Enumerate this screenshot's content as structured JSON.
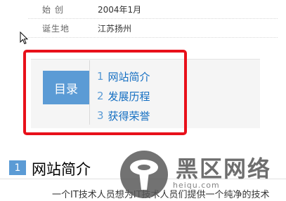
{
  "info": [
    {
      "key": "始 创",
      "value": "2004年1月"
    },
    {
      "key": "诞生地",
      "value": "江苏扬州"
    }
  ],
  "toc": {
    "label": "目录",
    "items": [
      {
        "num": "1",
        "text": "网站简介"
      },
      {
        "num": "2",
        "text": "发展历程"
      },
      {
        "num": "3",
        "text": "获得荣誉"
      }
    ]
  },
  "section": {
    "num": "1",
    "title": "网站简介",
    "paragraph": "一个IT技术人员想为IT技术人员们提供一个纯净的技术"
  },
  "watermark": {
    "text": "黑区网络",
    "url": "heiqu.com"
  },
  "colors": {
    "accent": "#5b9bd5",
    "link": "#136ec2",
    "highlight": "#e8101a"
  }
}
